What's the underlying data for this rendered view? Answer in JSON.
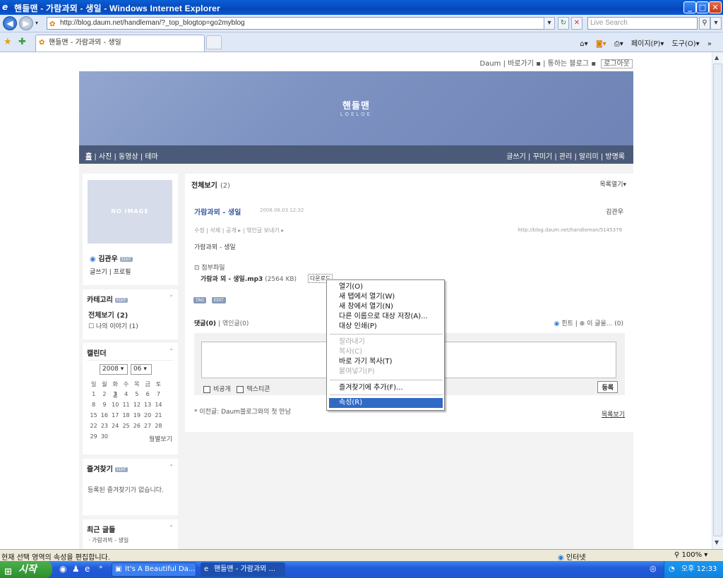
{
  "window": {
    "title": "핸들맨 - 가람과뫼 - 생일 - Windows Internet Explorer",
    "controls": {
      "minimize": "_",
      "maximize": "□",
      "close": "✕"
    }
  },
  "address": {
    "url": "http://blog.daum.net/handleman/?_top_blogtop=go2myblog",
    "search_placeholder": "Live Search"
  },
  "tab": {
    "title": "핸들맨 - 가람과뫼 - 생일"
  },
  "commandbar": {
    "page": "페이지(P)",
    "tools": "도구(O)"
  },
  "blog": {
    "topnav": {
      "daum": "Daum",
      "shortcut": "바로가기",
      "connected": "통하는 블로그",
      "logout": "로그아웃"
    },
    "banner": {
      "title": "핸들맨",
      "subtitle": "LOELOE"
    },
    "menu_left": {
      "home": "홈",
      "rest": " | 사진 | 동영상 | 테마"
    },
    "menu_right": "글쓰기 | 꾸미기 | 관리 | 알리미 | 방명록",
    "profile": {
      "noimage": "NO IMAGE",
      "name": "김관우",
      "links": "글쓰기 | 프로필",
      "edit": "EDIT"
    },
    "category": {
      "head": "카테고리",
      "all": "전체보기 (2)",
      "item1": "☐ 나의 이야기 (1)"
    },
    "calendar": {
      "head": "캘린더",
      "year": "2008",
      "month": "06",
      "weekdays": [
        "일",
        "월",
        "화",
        "수",
        "목",
        "금",
        "토"
      ],
      "weeks": [
        [
          "1",
          "2",
          "3",
          "4",
          "5",
          "6",
          "7"
        ],
        [
          "8",
          "9",
          "10",
          "11",
          "12",
          "13",
          "14"
        ],
        [
          "15",
          "16",
          "17",
          "18",
          "19",
          "20",
          "21"
        ],
        [
          "22",
          "23",
          "24",
          "25",
          "26",
          "27",
          "28"
        ],
        [
          "29",
          "30",
          "",
          "",
          "",
          "",
          ""
        ]
      ],
      "monthly": "월별보기"
    },
    "favorites": {
      "head": "즐겨찾기",
      "empty": "등록된 즐겨찾기가 없습니다."
    },
    "recent": {
      "head": "최근 글들",
      "first": "· 가람과뫼 - 생일"
    },
    "main": {
      "head": "전체보기",
      "count": "(2)",
      "list_open": "목록열기▾",
      "post_title": "가람과뫼 - 생일",
      "post_date": "2008.06.03 12:32",
      "author": "김관우",
      "actions": "수정 | 삭제 | 공개 ▸ | 엮인글 보내기 ▸",
      "post_url": "http://blog.daum.net/handleman/5145379",
      "body": "가람과뫼 - 생일",
      "attach_label": "⊡ 첨부파일",
      "attach_name": "가람과 뫼 - 생일.mp3",
      "attach_size": " (2564 KB)",
      "download": "다운로드",
      "tag1": "TAG",
      "tag2": "EDIT",
      "comments": "댓글(0)",
      "trackbacks": " | 엮인글(0)",
      "hint": "힌트 | ⊕ 이 글을... (0)",
      "private_label": "비공개",
      "emoticon_label": "텍스티콘",
      "submit": "등록",
      "prev_post": "* 이전글: Daum블로그와의 첫 만남",
      "list_view": "목록보기"
    }
  },
  "context_menu": {
    "items": [
      {
        "label": "열기(O)",
        "disabled": false
      },
      {
        "label": "새 탭에서 열기(W)",
        "disabled": false
      },
      {
        "label": "새 창에서 열기(N)",
        "disabled": false
      },
      {
        "label": "다른 이름으로 대상 저장(A)...",
        "disabled": false
      },
      {
        "label": "대상 인쇄(P)",
        "disabled": false
      },
      {
        "label": "잘라내기",
        "disabled": true
      },
      {
        "label": "복사(C)",
        "disabled": true
      },
      {
        "label": "바로 가기 복사(T)",
        "disabled": false
      },
      {
        "label": "붙여넣기(P)",
        "disabled": true
      },
      {
        "label": "즐겨찾기에 추가(F)...",
        "disabled": false
      },
      {
        "label": "속성(R)",
        "disabled": false,
        "selected": true
      }
    ]
  },
  "status": {
    "message": "현재 선택 영역의 속성을 편집합니다.",
    "zone": "인터넷",
    "zoom": "100%"
  },
  "taskbar": {
    "start": "시작",
    "tasks": [
      "It's A Beautiful Da...",
      "핸들맨 - 가람과뫼 ..."
    ],
    "clock": "오후 12:33"
  }
}
